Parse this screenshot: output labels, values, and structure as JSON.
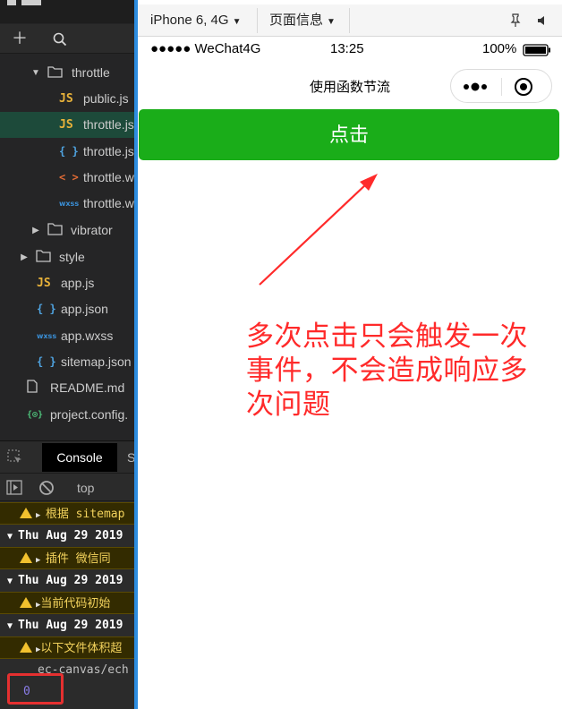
{
  "explorer": {
    "items": [
      {
        "label": "throttle",
        "type": "folder",
        "open": true
      },
      {
        "label": "public.js",
        "type": "js"
      },
      {
        "label": "throttle.js",
        "type": "js"
      },
      {
        "label": "throttle.js",
        "type": "json"
      },
      {
        "label": "throttle.w",
        "type": "wxml"
      },
      {
        "label": "throttle.w",
        "type": "wxss"
      },
      {
        "label": "vibrator",
        "type": "folder",
        "open": false
      },
      {
        "label": "style",
        "type": "folder",
        "open": false
      },
      {
        "label": "app.js",
        "type": "js"
      },
      {
        "label": "app.json",
        "type": "json"
      },
      {
        "label": "app.wxss",
        "type": "wxss"
      },
      {
        "label": "sitemap.json",
        "type": "json"
      },
      {
        "label": "README.md",
        "type": "file"
      },
      {
        "label": "project.config.",
        "type": "config"
      }
    ],
    "icon_glyphs": {
      "js": "JS",
      "json": "{ }",
      "wxml": "< >",
      "wxss": "wxss",
      "config": "{⊙}"
    }
  },
  "console": {
    "tab_label": "Console",
    "tab2_label": "S",
    "filter_label": "top",
    "rows": [
      {
        "kind": "warn",
        "text": "根据 sitemap"
      },
      {
        "kind": "group",
        "text": "Thu Aug 29 2019"
      },
      {
        "kind": "warn",
        "text": "插件 微信同"
      },
      {
        "kind": "group",
        "text": "Thu Aug 29 2019"
      },
      {
        "kind": "warn",
        "text": "当前代码初始"
      },
      {
        "kind": "group",
        "text": "Thu Aug 29 2019"
      },
      {
        "kind": "warn",
        "text": "以下文件体积超"
      },
      {
        "kind": "plain",
        "text": "ec-canvas/ech"
      }
    ],
    "output_value": "0"
  },
  "simulator": {
    "device": "iPhone 6, 4G",
    "page_info": "页面信息",
    "status": {
      "signal": "●●●●● WeChat4G",
      "time": "13:25",
      "battery": "100%"
    },
    "nav_title": "使用函数节流",
    "button_label": "点击",
    "annotation": "多次点击只会触发一次事件，不会造成响应多次问题"
  },
  "colors": {
    "primary_button": "#1aad19",
    "annotation": "#ff2a2a",
    "ide_bg": "#252526",
    "highlight_box": "#e53030"
  }
}
